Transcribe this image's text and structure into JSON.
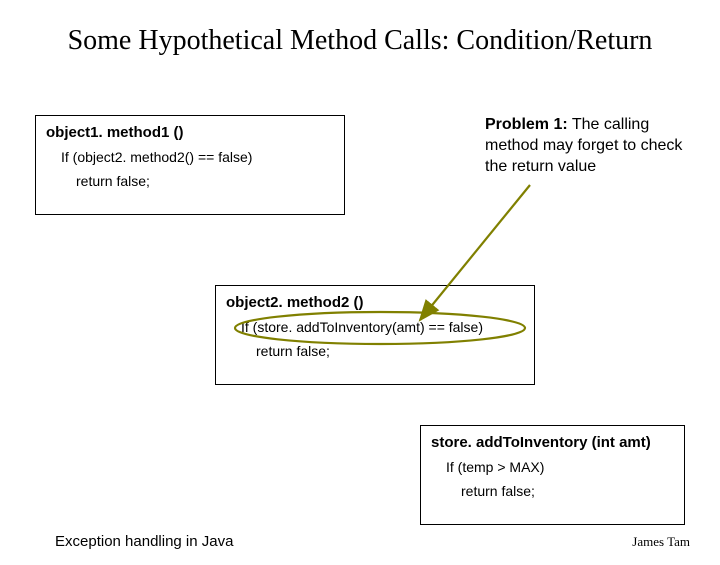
{
  "title": "Some Hypothetical Method Calls: Condition/Return",
  "box1": {
    "sig": "object1. method1 ()",
    "line1": "If (object2. method2() == false)",
    "line2": "return false;"
  },
  "box2": {
    "sig": "object2. method2 ()",
    "line1": "If (store. addToInventory(amt) == false)",
    "line2": "return false;"
  },
  "box3": {
    "sig": "store. addToInventory (int amt)",
    "line1": "If (temp > MAX)",
    "line2": "return false;"
  },
  "problem": {
    "label": "Problem 1:",
    "text": "  The calling method may forget to check the return value"
  },
  "footer": {
    "left": "Exception handling in Java",
    "right": "James Tam"
  }
}
